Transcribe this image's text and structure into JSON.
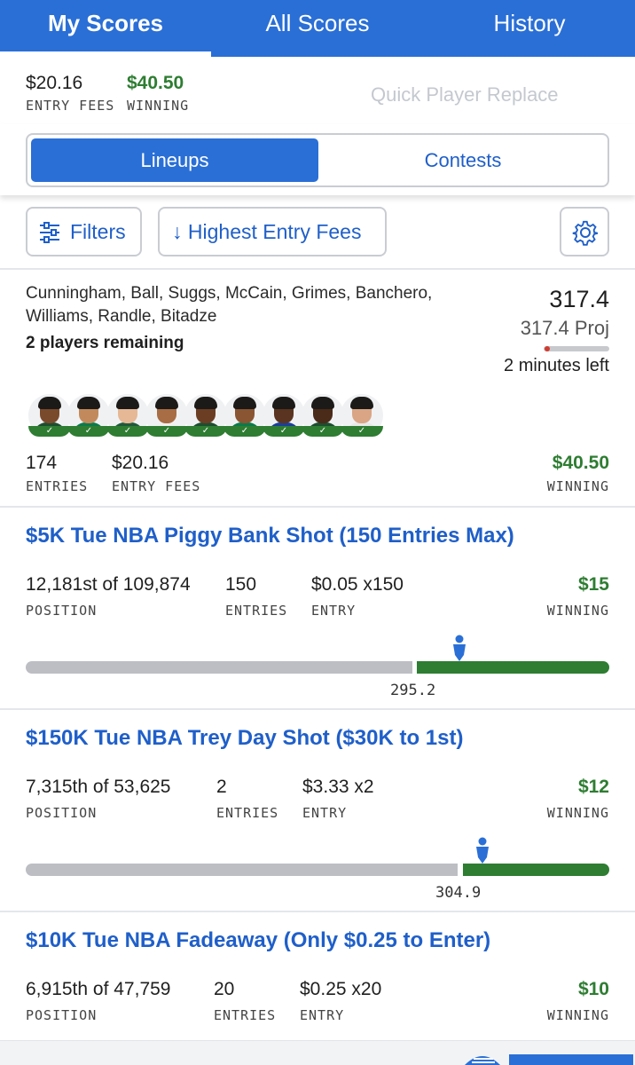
{
  "tabs": [
    {
      "label": "My Scores"
    },
    {
      "label": "All Scores"
    },
    {
      "label": "History"
    }
  ],
  "summary": {
    "entry_fees_value": "$20.16",
    "entry_fees_label": "ENTRY FEES",
    "winning_value": "$40.50",
    "winning_label": "WINNING",
    "quick_replace_label": "Quick Player Replace"
  },
  "segment": {
    "lineups_label": "Lineups",
    "contests_label": "Contests"
  },
  "filters": {
    "filters_label": "Filters",
    "sort_label": "↓ Highest Entry Fees"
  },
  "lineup": {
    "players_text": "Cunningham, Ball, Suggs, McCain, Grimes, Banchero, Williams, Randle, Bitadze",
    "remaining": "2 players remaining",
    "score": "317.4",
    "proj": "317.4 Proj",
    "proj_progress": 0.02,
    "time_left": "2 minutes left",
    "entries_value": "174",
    "entries_label": "ENTRIES",
    "fees_value": "$20.16",
    "fees_label": "ENTRY FEES",
    "winning_value": "$40.50",
    "winning_label": "WINNING",
    "avatars": [
      {
        "name": "player-1",
        "skin": "#7a4a2c",
        "jersey": "#1d4e2f"
      },
      {
        "name": "player-2",
        "skin": "#c28a5c",
        "jersey": "#0c7a4a"
      },
      {
        "name": "player-3",
        "skin": "#e6b896",
        "jersey": "#1f5a3a"
      },
      {
        "name": "player-4",
        "skin": "#a86d44",
        "jersey": "#f0f0f0"
      },
      {
        "name": "player-5",
        "skin": "#6b3e24",
        "jersey": "#1d4e2f"
      },
      {
        "name": "player-6",
        "skin": "#8a5532",
        "jersey": "#0c7a4a"
      },
      {
        "name": "player-7",
        "skin": "#5a3420",
        "jersey": "#1c3f9a"
      },
      {
        "name": "player-8",
        "skin": "#4a2a18",
        "jersey": "#1d4e2f"
      },
      {
        "name": "player-9",
        "skin": "#d9a585",
        "jersey": "#e8e8e8"
      }
    ]
  },
  "contests": [
    {
      "title": "$5K Tue NBA Piggy Bank Shot (150 Entries Max)",
      "position": "12,181st of 109,874",
      "position_label": "POSITION",
      "entries": "150",
      "entries_label": "ENTRIES",
      "entry": "$0.05 x150",
      "entry_label": "ENTRY",
      "winning": "$15",
      "winning_label": "WINNING",
      "cutline": "295.2"
    },
    {
      "title": "$150K Tue NBA Trey Day Shot ($30K to 1st)",
      "position": "7,315th of 53,625",
      "position_label": "POSITION",
      "entries": "2",
      "entries_label": "ENTRIES",
      "entry": "$3.33 x2",
      "entry_label": "ENTRY",
      "winning": "$12",
      "winning_label": "WINNING",
      "cutline": "304.9"
    },
    {
      "title": "$10K Tue NBA Fadeaway (Only $0.25 to Enter)",
      "position": "6,915th of 47,759",
      "position_label": "POSITION",
      "entries": "20",
      "entries_label": "ENTRIES",
      "entry": "$0.25 x20",
      "entry_label": "ENTRY",
      "winning": "$10",
      "winning_label": "WINNING"
    }
  ],
  "colors": {
    "brand_blue": "#2a6fd6",
    "link_blue": "#1f5fc9",
    "win_green": "#2e7d32",
    "bar_gray": "#bcbec3"
  }
}
